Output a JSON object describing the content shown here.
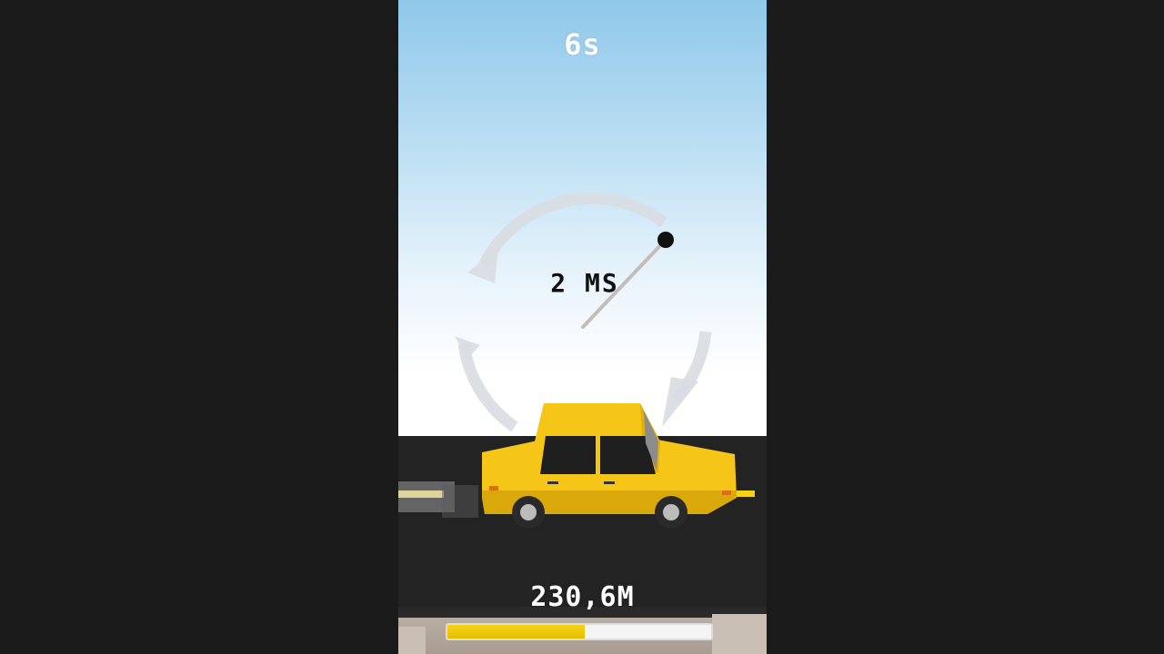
{
  "hud": {
    "timer_text": "6s",
    "gauge_text": "2 MS",
    "distance_text": "230,6M"
  },
  "progress": {
    "fraction": 0.52
  },
  "colors": {
    "car_body": "#f5c518",
    "road": "#232323",
    "progress_fill": "#f5d312"
  },
  "icons": {
    "rotate_arrows": "rotate-arrows-icon"
  }
}
